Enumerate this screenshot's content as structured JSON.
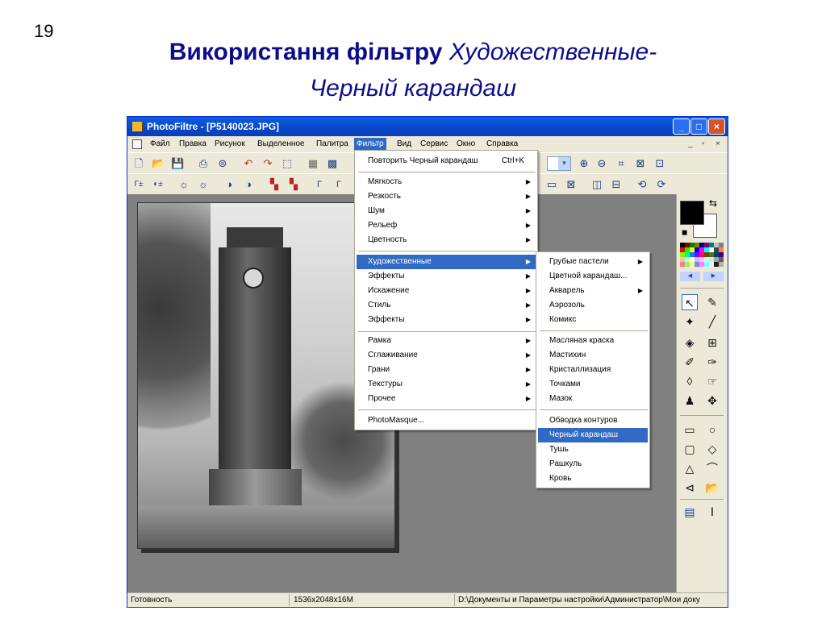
{
  "slide": {
    "number": "19",
    "title_bold": "Використання фільтру ",
    "title_italic_1": "Художественные-",
    "title_italic_2": "Черный карандаш"
  },
  "window": {
    "title": "PhotoFiltre - [P5140023.JPG]",
    "minimize": "_",
    "maximize": "□",
    "close": "×"
  },
  "menubar": {
    "items": [
      "Файл",
      "Правка",
      "Рисунок",
      "Выделенное",
      "Палитра",
      "Фильтр",
      "Вид",
      "Сервис",
      "Окно",
      "Справка"
    ],
    "active": "Фильтр",
    "mdi": [
      "_",
      "▫",
      "×"
    ]
  },
  "filter_menu": {
    "repeat": "Повторить Черный карандаш",
    "repeat_shortcut": "Ctrl+K",
    "group1": [
      "Мягкость",
      "Резкость",
      "Шум",
      "Рельеф",
      "Цветность"
    ],
    "group2": [
      "Художественные",
      "Эффекты",
      "Искажение",
      "Стиль",
      "Эффекты"
    ],
    "group3": [
      "Рамка",
      "Сглаживание",
      "Грани",
      "Текстуры",
      "Прочее"
    ],
    "photomasque": "PhotoMasque..."
  },
  "art_submenu": {
    "group1": [
      "Грубые пастели",
      "Цветной карандаш...",
      "Акварель",
      "Аэрозоль",
      "Комикс"
    ],
    "group2": [
      "Масляная краска",
      "Мастихин",
      "Кристаллизация",
      "Точками",
      "Мазок"
    ],
    "group3": [
      "Обводка контуров",
      "Черный карандаш",
      "Тушь",
      "Рашкуль",
      "Кровь"
    ],
    "highlighted": "Черный карандаш"
  },
  "statusbar": {
    "state": "Готовность",
    "size": "1536x2048x16M",
    "path": "D:\\Документы и Параметры настройки\\Администратор\\Мои доку"
  },
  "colors": {
    "title_blue": "#0d0d8c",
    "highlight": "#316ac5",
    "foreground": "#000000",
    "background": "#ffffff"
  }
}
